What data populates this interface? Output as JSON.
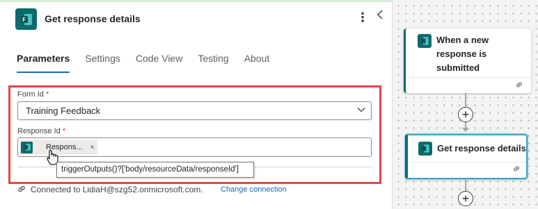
{
  "panel": {
    "title": "Get response details",
    "tabs": [
      {
        "label": "Parameters",
        "active": true
      },
      {
        "label": "Settings",
        "active": false
      },
      {
        "label": "Code View",
        "active": false
      },
      {
        "label": "Testing",
        "active": false
      },
      {
        "label": "About",
        "active": false
      }
    ],
    "form_id": {
      "label": "Form Id",
      "required_mark": "*",
      "value": "Training Feedback"
    },
    "response_id": {
      "label": "Response Id",
      "required_mark": "*",
      "token_label": "Respons...",
      "token_remove": "×"
    },
    "tooltip": "triggerOutputs()?['body/resourceData/responseId']",
    "connection": {
      "text": "Connected to LidiaH@szg52.onmicrosoft.com.",
      "change_link": "Change connection"
    }
  },
  "canvas": {
    "trigger_card": {
      "title": "When a new response is submitted"
    },
    "action_card": {
      "title": "Get response details"
    },
    "add_step": "+"
  },
  "colors": {
    "accent": "#0f6cbd",
    "forms_teal": "#0d6b6b",
    "highlight_red": "#e04848",
    "selected_card_border": "#3aa6c8"
  }
}
